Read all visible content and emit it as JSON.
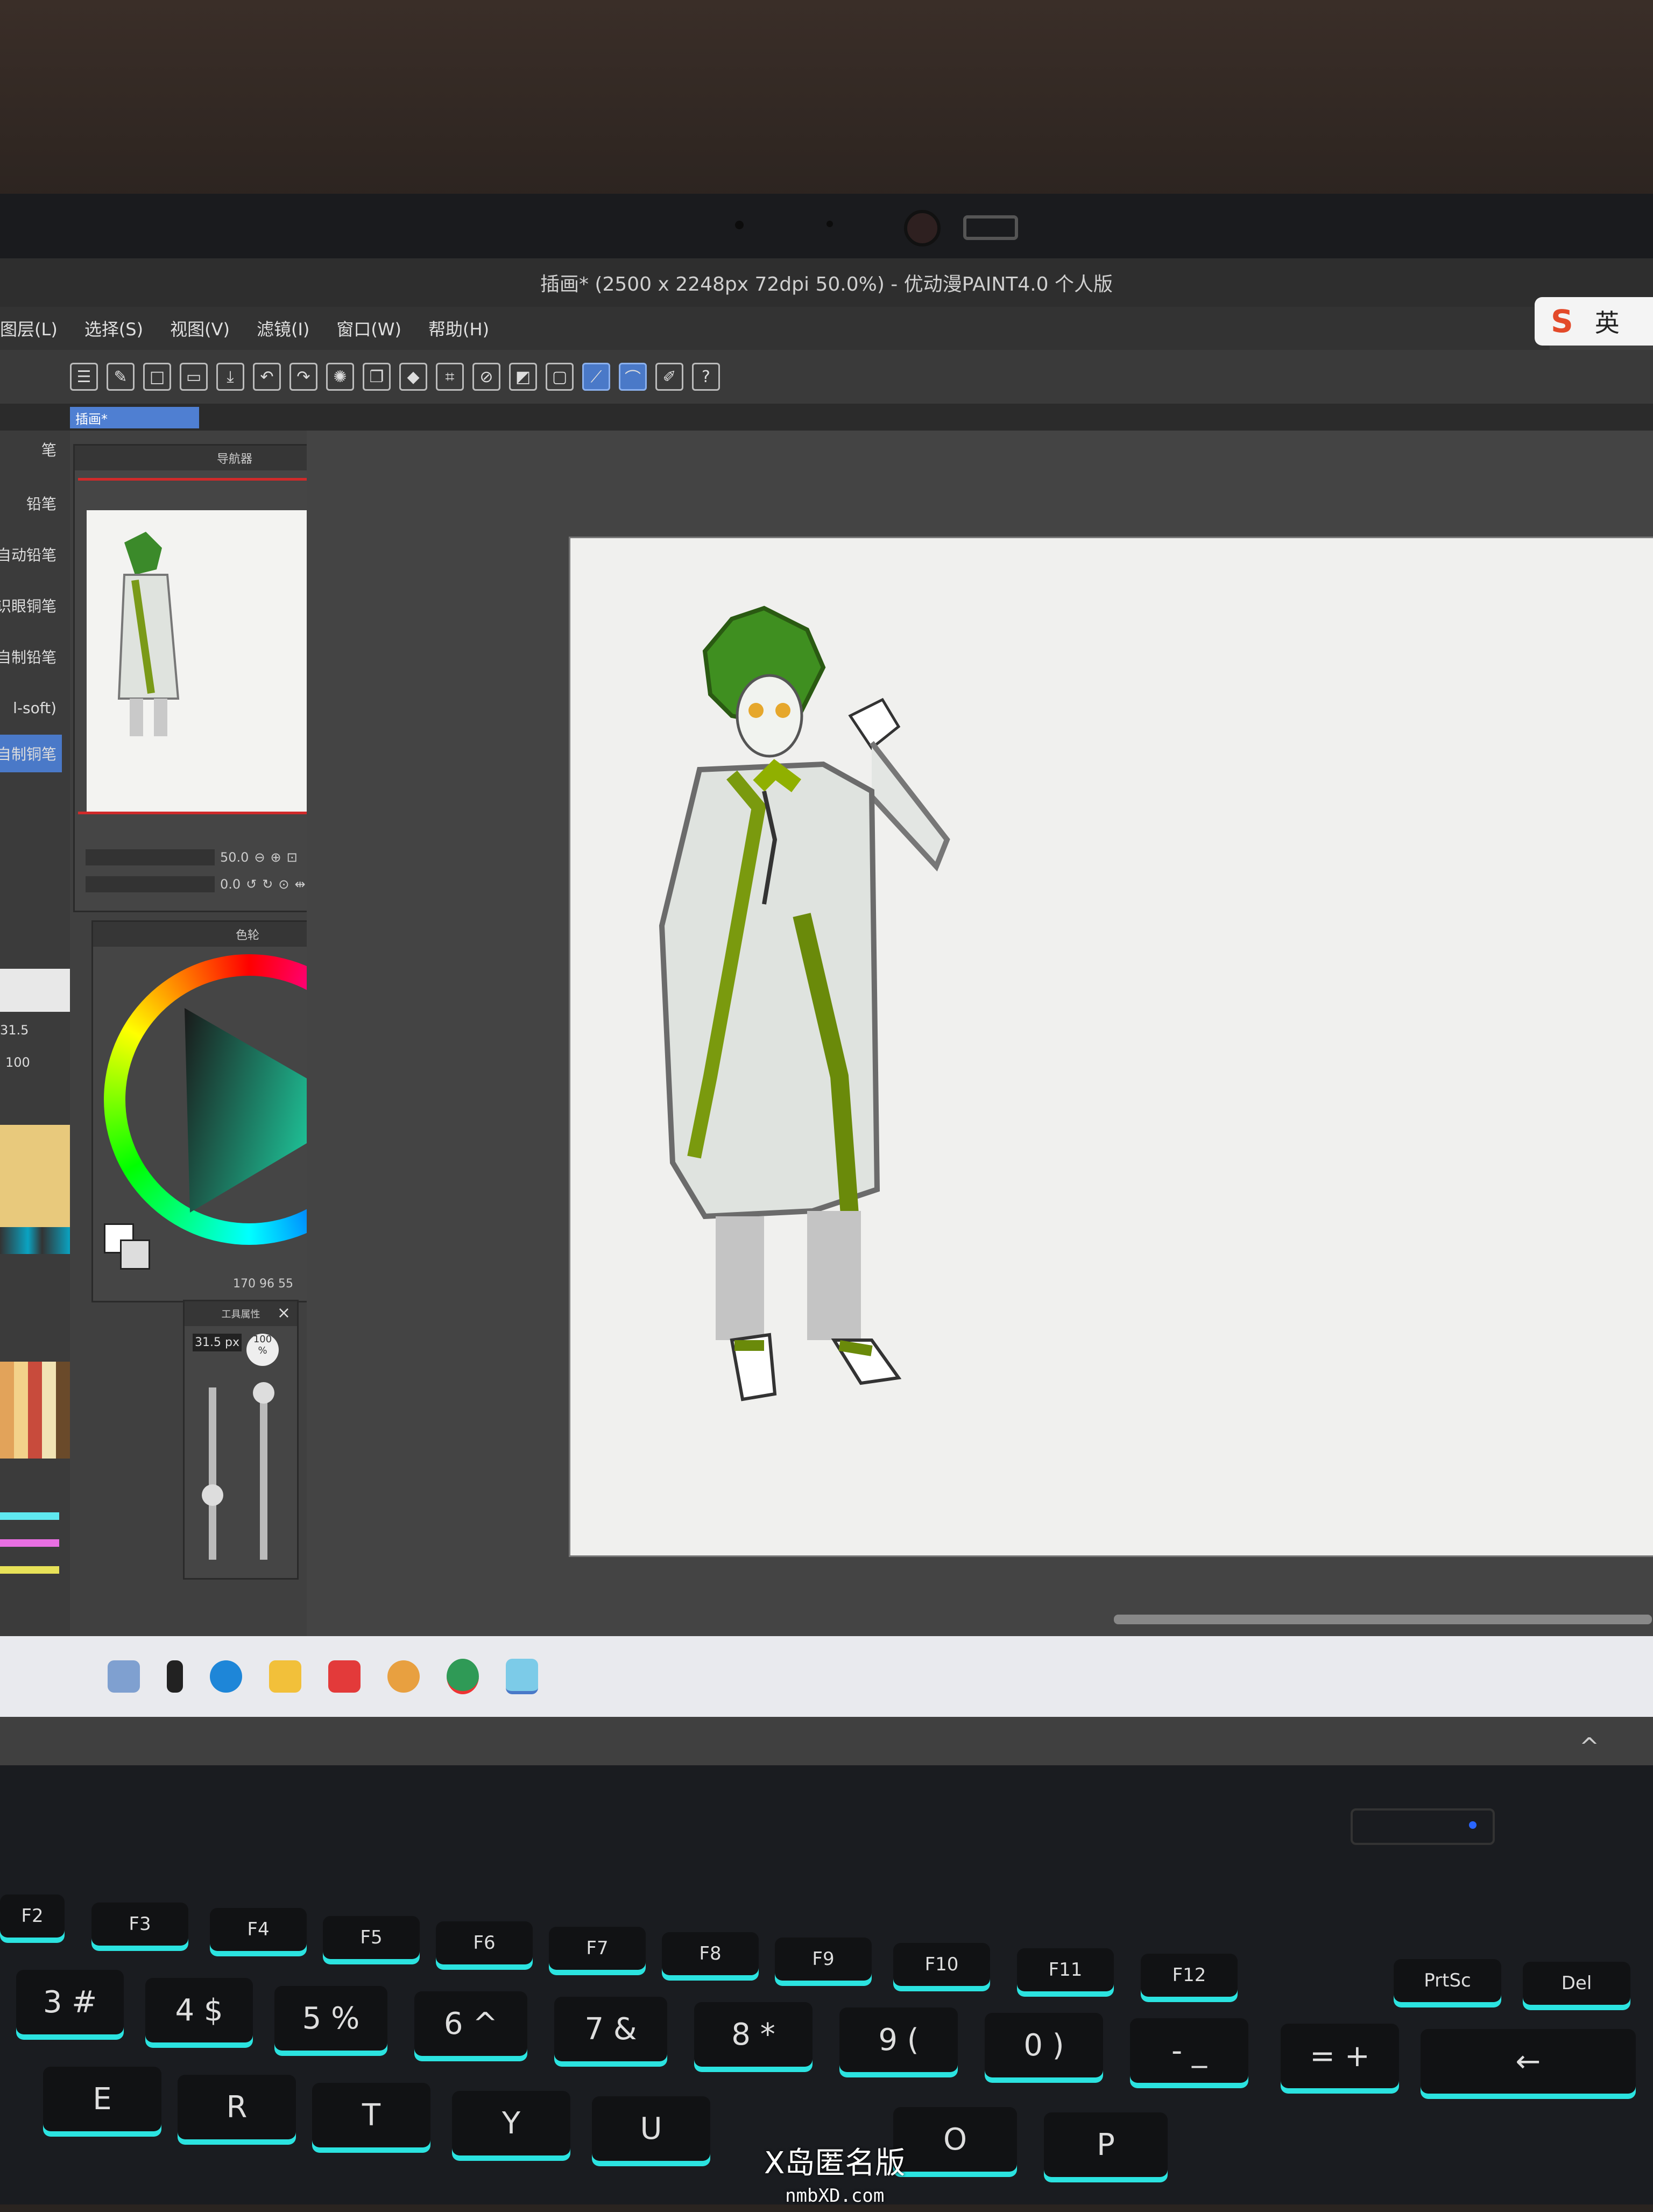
{
  "window": {
    "title": "插画* (2500 x 2248px 72dpi 50.0%)  - 优动漫PAINT4.0 个人版"
  },
  "ime": {
    "logo": "S",
    "mode": "英"
  },
  "menu": [
    "图层(L)",
    "选择(S)",
    "视图(V)",
    "滤镜(I)",
    "窗口(W)",
    "帮助(H)"
  ],
  "document_tab": {
    "label": "插画*"
  },
  "brush_list": {
    "header": "笔",
    "items": [
      "铅笔",
      "自动铅笔",
      "识眼铜笔",
      "自制铅笔",
      "l-soft)",
      "自制铜笔"
    ],
    "selected_index": 5
  },
  "navigator": {
    "title": "导航器",
    "zoom": "50.0",
    "rotation": "0.0"
  },
  "color_panel": {
    "title": "色轮",
    "readout": "170   96   55"
  },
  "brush_size": {
    "title": "工具属性",
    "size": "31.5",
    "unit": "px",
    "opacity": "100",
    "opacity_unit": "%",
    "left_values": [
      "31.5",
      "100"
    ]
  },
  "taskbar": {
    "apps": [
      "app-a",
      "app-b",
      "edge",
      "folder",
      "netease",
      "chrome",
      "pdf",
      "paint"
    ]
  },
  "keyboard": {
    "fn_row": [
      "F2",
      "F3",
      "F4",
      "F5",
      "F6",
      "F7",
      "F8",
      "F9",
      "F10",
      "F11",
      "F12",
      "PrtSc",
      "Del"
    ],
    "num_row": [
      "3 #",
      "4 $",
      "5 %",
      "6 ^",
      "7 &",
      "8 *",
      "9 (",
      "0 )",
      "- _",
      "= +",
      "←"
    ],
    "letter_row": [
      "E",
      "R",
      "T",
      "Y",
      "U",
      "O",
      "P"
    ]
  },
  "watermark": {
    "line1": "X岛匿名版",
    "line2": "nmbXD.com"
  },
  "colors": {
    "accent": "#4a79c8",
    "key_glow": "#2be3e0",
    "tab": "#4f7fd2"
  }
}
